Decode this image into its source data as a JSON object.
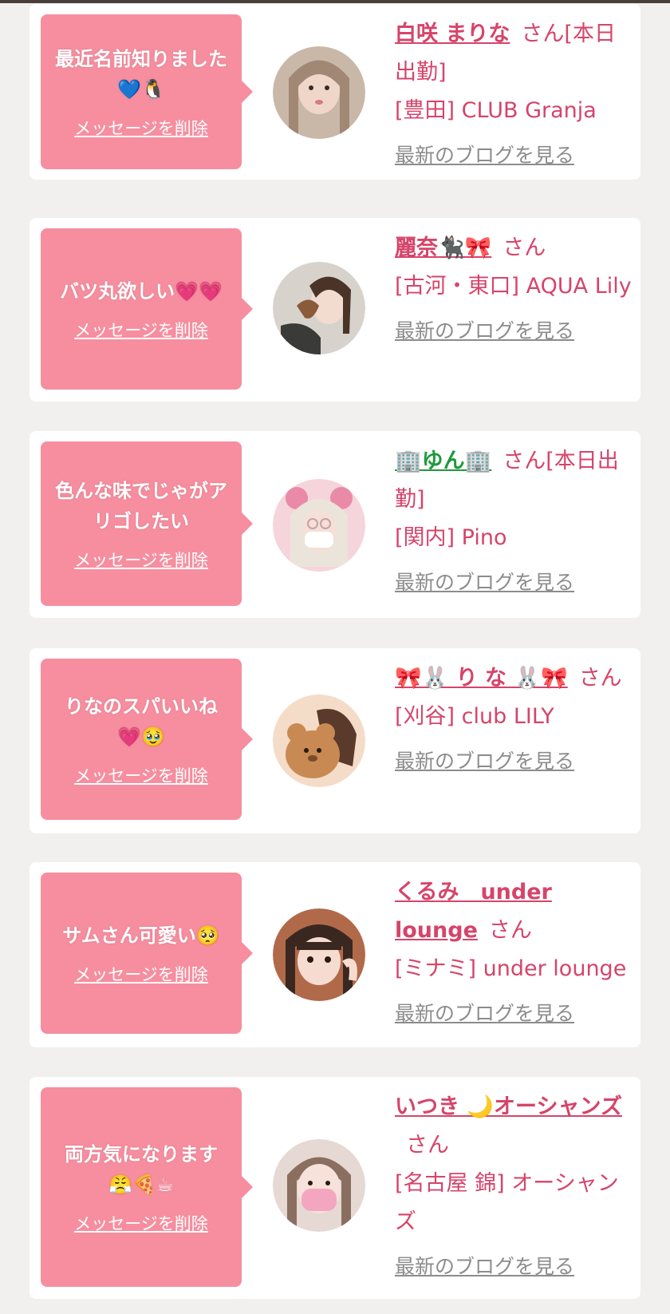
{
  "items": [
    {
      "message": "最近名前知りました",
      "message_emoji": "💙🐧",
      "delete_label": "メッセージを削除",
      "name": "白咲 まりな",
      "name_emoji": "",
      "suffix": "さん[本日出勤]",
      "shop": "[豊田] CLUB Granja",
      "blog_label": "最新のブログを見る"
    },
    {
      "message": "バツ丸欲しい",
      "message_emoji": "💗💗",
      "delete_label": "メッセージを削除",
      "name": "麗奈",
      "name_emoji": "🐈‍⬛🎀",
      "suffix": "さん",
      "shop": "[古河・東口] AQUA Lily",
      "blog_label": "最新のブログを見る"
    },
    {
      "message": "色んな味でじゃがアリゴしたい",
      "message_emoji": "",
      "delete_label": "メッセージを削除",
      "name": "🏢ゆん🏢",
      "name_emoji": "",
      "suffix": "さん[本日出勤]",
      "shop": "[関内] Pino",
      "blog_label": "最新のブログを見る"
    },
    {
      "message": "りなのスパいいね",
      "message_emoji": "💗🥹",
      "delete_label": "メッセージを削除",
      "name": "🎀🐰 り な 🐰🎀",
      "name_emoji": "",
      "suffix": "さん",
      "shop": "[刈谷] club LILY",
      "blog_label": "最新のブログを見る"
    },
    {
      "message": "サムさん可愛い",
      "message_emoji": "🥺",
      "delete_label": "メッセージを削除",
      "name": "くるみ　under lounge",
      "name_emoji": "",
      "suffix": "さん",
      "shop": "[ミナミ] under lounge",
      "blog_label": "最新のブログを見る"
    },
    {
      "message": "両方気になります",
      "message_emoji": "😤🍕☕",
      "delete_label": "メッセージを削除",
      "name": "いつき 🌙オーシャンズ",
      "name_emoji": "",
      "suffix": "さん",
      "shop": "[名古屋 錦] オーシャンズ",
      "blog_label": "最新のブログを見る"
    }
  ],
  "colors": {
    "bubble": "#f68e9f",
    "accent": "#d6446a",
    "link_gray": "#8c8c8c",
    "background": "#f2f0ee"
  }
}
